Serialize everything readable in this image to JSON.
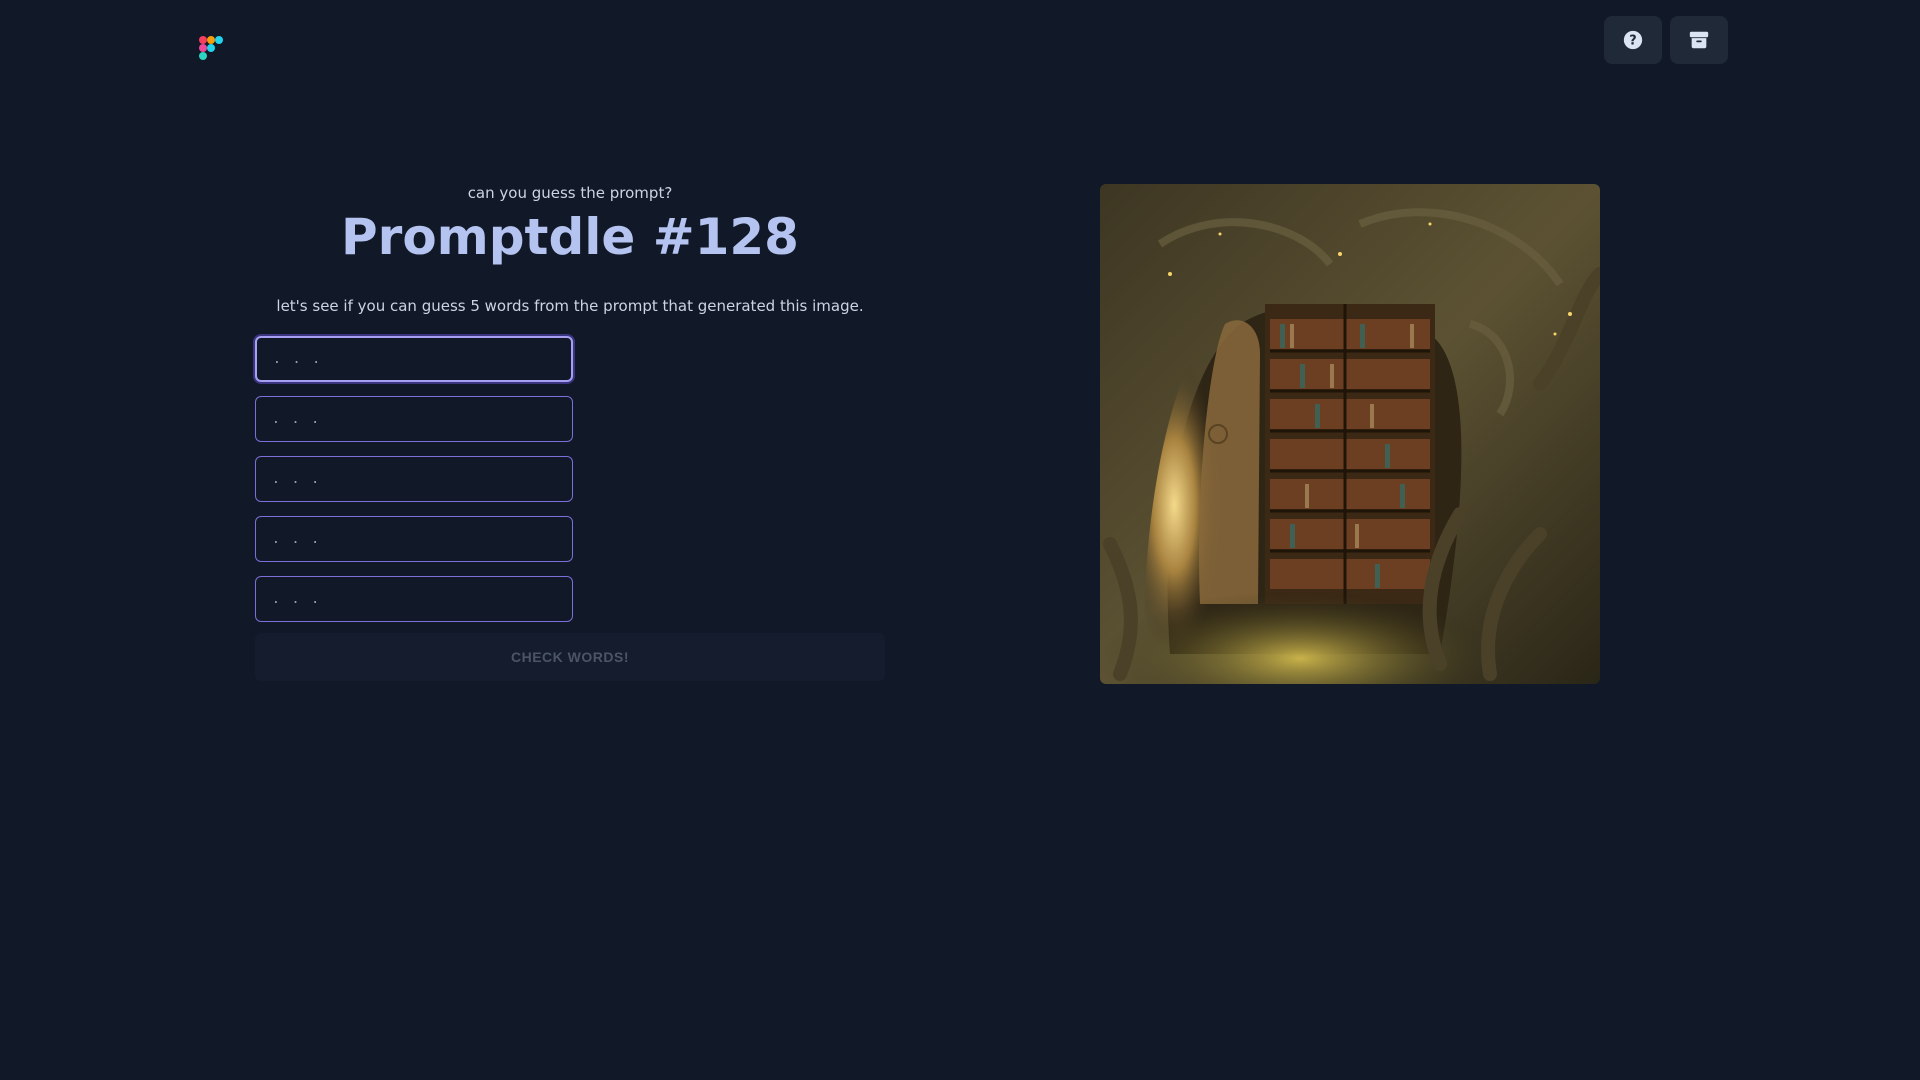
{
  "header": {
    "logo_icon": "promptdle-logo-icon",
    "help_icon": "question-circle-icon",
    "archive_icon": "archive-box-icon"
  },
  "game": {
    "tagline": "can you guess the prompt?",
    "title": "Promptdle #128",
    "instructions": "let's see if you can guess 5 words from the prompt that generated this image.",
    "guesses": [
      {
        "value": "",
        "placeholder": ". . ."
      },
      {
        "value": "",
        "placeholder": ". . ."
      },
      {
        "value": "",
        "placeholder": ". . ."
      },
      {
        "value": "",
        "placeholder": ". . ."
      },
      {
        "value": "",
        "placeholder": ". . ."
      }
    ],
    "check_label": "CHECK WORDS!"
  },
  "colors": {
    "background": "#111827",
    "accent": "#7c6fd8",
    "title": "#b4c3f0"
  }
}
